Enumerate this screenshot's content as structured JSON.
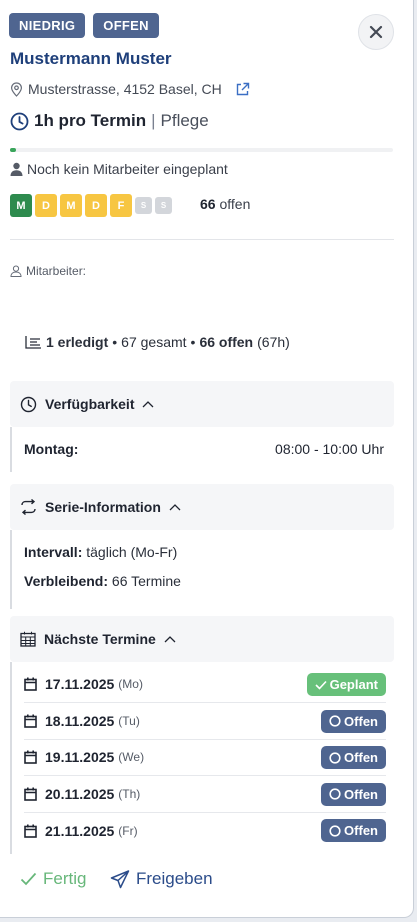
{
  "badges": {
    "priority": "NIEDRIG",
    "status": "OFFEN"
  },
  "client": {
    "name": "Mustermann Muster",
    "address": "Musterstrasse, 4152 Basel, CH"
  },
  "duration": {
    "value": "1h pro Termin",
    "separator": "|",
    "type": "Pflege"
  },
  "progress": {
    "completed_fraction": 0.015,
    "color": "#3aa55b"
  },
  "staff_status": "Noch kein Mitarbeiter eingeplant",
  "weekdays": [
    {
      "label": "M",
      "state": "done"
    },
    {
      "label": "D",
      "state": "open"
    },
    {
      "label": "M",
      "state": "open"
    },
    {
      "label": "D",
      "state": "open"
    },
    {
      "label": "F",
      "state": "open"
    },
    {
      "label": "S",
      "state": "none"
    },
    {
      "label": "S",
      "state": "none"
    }
  ],
  "open_count": {
    "number": "66",
    "label": "offen"
  },
  "staff_label": "Mitarbeiter:",
  "summary": {
    "done": "1 erledigt",
    "dot1": "•",
    "total": "67 gesamt",
    "dot2": "•",
    "open": "66 offen",
    "hours": "(67h)"
  },
  "availability": {
    "title": "Verfügbarkeit",
    "rows": [
      {
        "day": "Montag:",
        "time": "08:00 - 10:00 Uhr"
      }
    ]
  },
  "series": {
    "title": "Serie-Information",
    "interval_label": "Intervall:",
    "interval_value": "täglich (Mo-Fr)",
    "remaining_label": "Verbleibend:",
    "remaining_value": "66 Termine"
  },
  "appointments": {
    "title": "Nächste Termine",
    "items": [
      {
        "date": "17.11.2025",
        "dow": "(Mo)",
        "status": "Geplant",
        "kind": "planned"
      },
      {
        "date": "18.11.2025",
        "dow": "(Tu)",
        "status": "Offen",
        "kind": "open"
      },
      {
        "date": "19.11.2025",
        "dow": "(We)",
        "status": "Offen",
        "kind": "open"
      },
      {
        "date": "20.11.2025",
        "dow": "(Th)",
        "status": "Offen",
        "kind": "open"
      },
      {
        "date": "21.11.2025",
        "dow": "(Fr)",
        "status": "Offen",
        "kind": "open"
      }
    ]
  },
  "footer": {
    "done": "Fertig",
    "share": "Freigeben"
  },
  "colors": {
    "accent": "#4f6590",
    "name": "#1e3f7a",
    "planned": "#67c07a",
    "day_done": "#2e8b4e",
    "day_open": "#f7c642"
  }
}
